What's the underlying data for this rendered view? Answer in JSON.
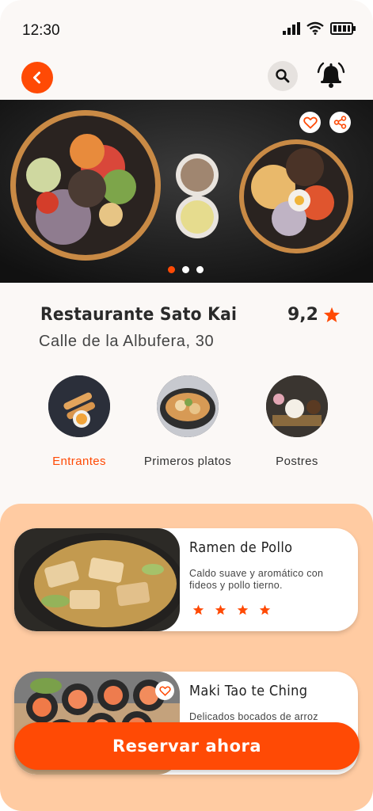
{
  "status_bar": {
    "time": "12:30"
  },
  "header": {
    "back_icon": "chevron-left-icon",
    "search_icon": "search-icon",
    "bell_icon": "bell-icon"
  },
  "hero": {
    "fav_icon": "heart-icon",
    "share_icon": "share-icon",
    "carousel_active": 1,
    "carousel_count": 3
  },
  "restaurant": {
    "name": "Restaurante Sato Kai",
    "address": "Calle de la Albufera, 30",
    "rating": "9,2",
    "rating_icon": "star-icon"
  },
  "categories": [
    {
      "label": "Entrantes",
      "active": true
    },
    {
      "label": "Primeros platos",
      "active": false
    },
    {
      "label": "Postres",
      "active": false
    }
  ],
  "dishes": [
    {
      "title": "Ramen de Pollo",
      "description": "Caldo suave y aromático con fideos y pollo tierno.",
      "stars": 4
    },
    {
      "title": "Maki Tao te Ching",
      "description": "Delicados bocados de arroz avinagrado con pescado"
    }
  ],
  "cta": {
    "label": "Reservar ahora"
  },
  "colors": {
    "accent": "#ff4a05",
    "panel": "#ffcba2",
    "background": "#fbf8f6"
  }
}
